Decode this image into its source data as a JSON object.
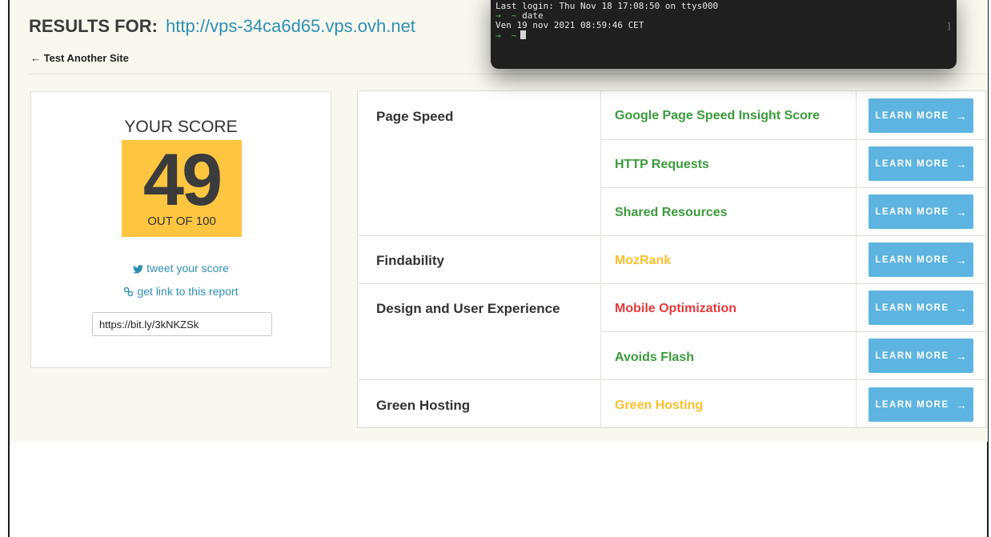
{
  "header": {
    "results_label": "RESULTS FOR:",
    "results_url": "http://vps-34ca6d65.vps.ovh.net",
    "back_link": "Test Another Site"
  },
  "score": {
    "heading": "YOUR SCORE",
    "value": "49",
    "out_of": "OUT OF 100",
    "tweet_label": "tweet your score",
    "link_label": "get link to this report",
    "short_url": "https://bit.ly/3kNKZSk"
  },
  "table": {
    "button_label": "LEARN MORE",
    "categories": [
      {
        "name": "Page Speed"
      },
      {
        "name": "Findability"
      },
      {
        "name": "Design and User Experience"
      },
      {
        "name": "Green Hosting"
      }
    ],
    "rows": [
      {
        "metric": "Google Page Speed Insight Score",
        "status_color": "#3b9b3b"
      },
      {
        "metric": "HTTP Requests",
        "status_color": "#3b9b3b"
      },
      {
        "metric": "Shared Resources",
        "status_color": "#3b9b3b"
      },
      {
        "metric": "MozRank",
        "status_color": "#fbbf2e"
      },
      {
        "metric": "Mobile Optimization",
        "status_color": "#e23b3b"
      },
      {
        "metric": "Avoids Flash",
        "status_color": "#3b9b3b"
      },
      {
        "metric": "Green Hosting",
        "status_color": "#fbbf2e"
      }
    ]
  },
  "terminal": {
    "line1": "Last login: Thu Nov 18 17:08:50 on ttys000",
    "prompt_symbol": "→  ~",
    "command": "date",
    "output": "Ven 19 nov 2021 08:59:46 CET"
  },
  "colors": {
    "accent": "#2e8fb3",
    "score_bg": "#fec541",
    "button_bg": "#5eb4e0",
    "good": "#3b9b3b",
    "warning": "#fbbf2e",
    "bad": "#e23b3b"
  }
}
